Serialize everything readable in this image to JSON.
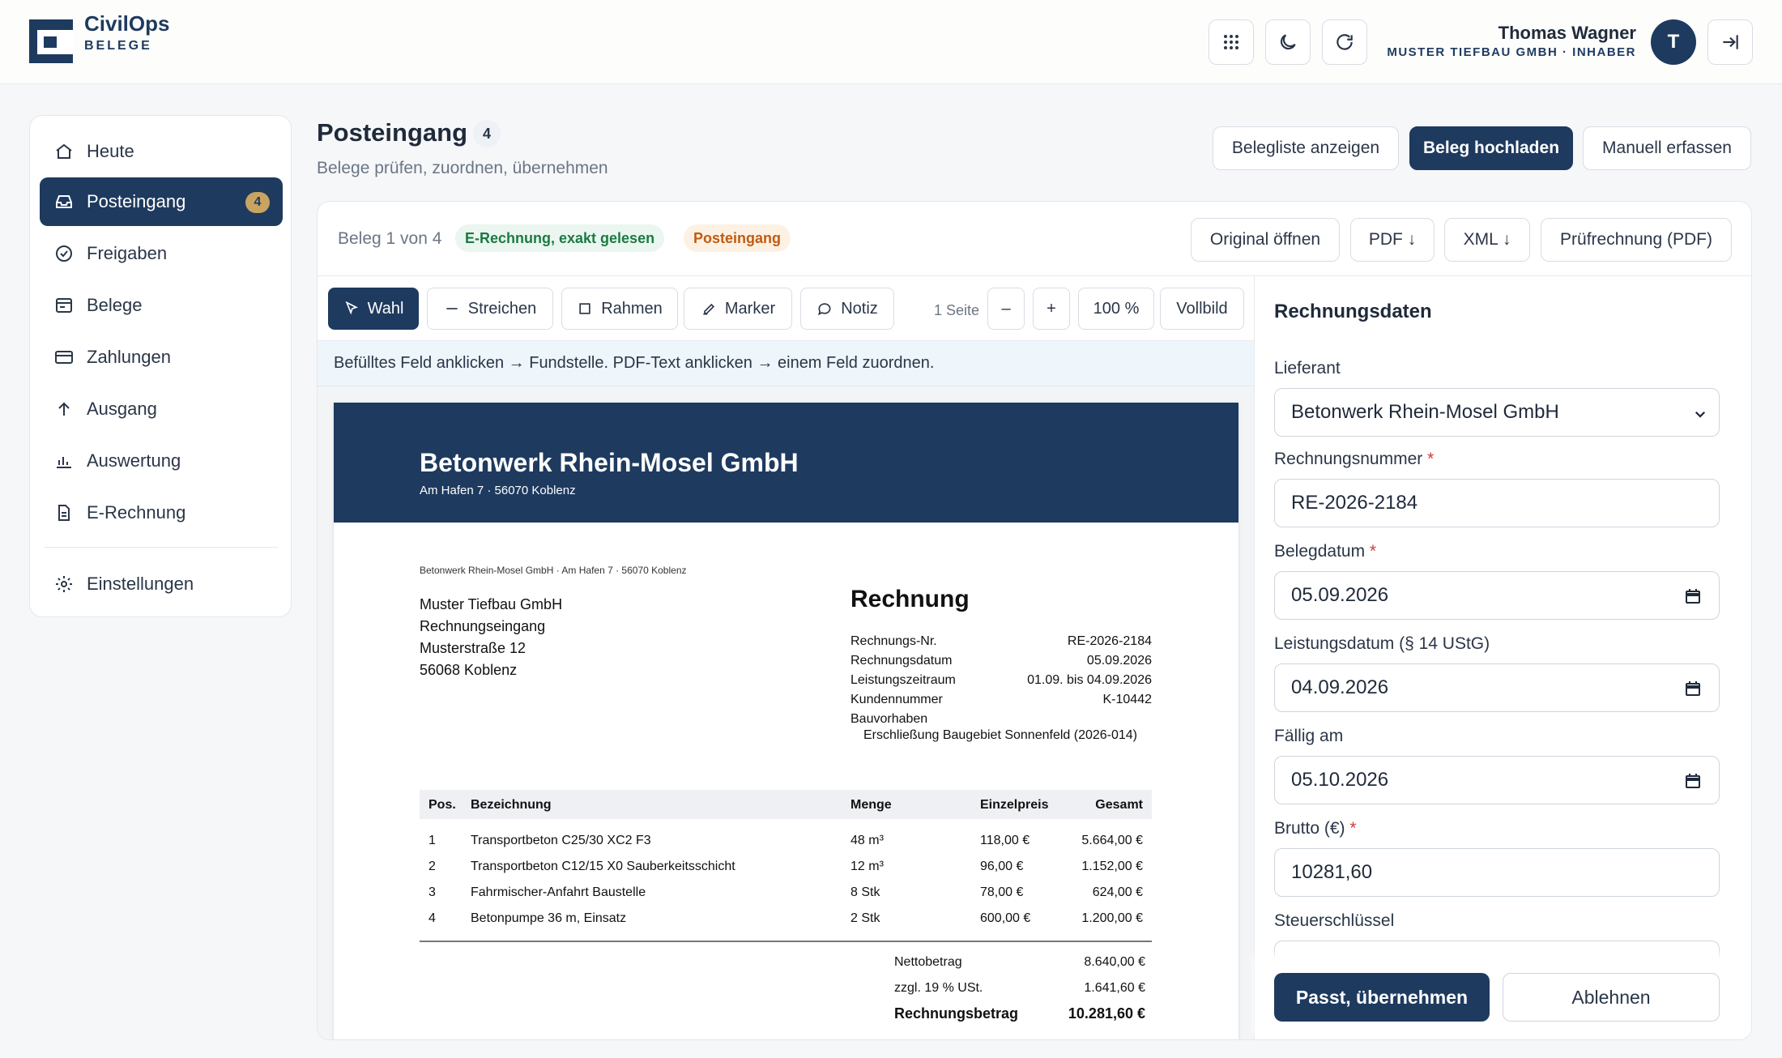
{
  "app": {
    "name": "CivilOps",
    "subtitle": "BELEGE"
  },
  "user": {
    "name": "Thomas Wagner",
    "role": "MUSTER TIEFBAU GMBH · INHABER",
    "initial": "T"
  },
  "topbar_icons": [
    "apps-grid-icon",
    "moon-icon",
    "refresh-icon",
    "logout-icon"
  ],
  "sidebar": {
    "items": [
      {
        "label": "Heute",
        "icon": "home-icon"
      },
      {
        "label": "Posteingang",
        "icon": "inbox-icon",
        "badge": "4",
        "active": true
      },
      {
        "label": "Freigaben",
        "icon": "check-circle-icon"
      },
      {
        "label": "Belege",
        "icon": "document-icon"
      },
      {
        "label": "Zahlungen",
        "icon": "credit-card-icon"
      },
      {
        "label": "Ausgang",
        "icon": "arrow-up-icon"
      },
      {
        "label": "Auswertung",
        "icon": "bar-chart-icon"
      },
      {
        "label": "E-Rechnung",
        "icon": "file-text-icon"
      }
    ],
    "settings": {
      "label": "Einstellungen",
      "icon": "gear-icon"
    }
  },
  "page": {
    "title": "Posteingang",
    "count": "4",
    "subtitle": "Belege prüfen, zuordnen, übernehmen",
    "actions": [
      "Belegliste anzeigen",
      "Beleg hochladen",
      "Manuell erfassen"
    ]
  },
  "card": {
    "position": "Beleg 1 von 4",
    "chip_erechnung": "E-Rechnung, exakt gelesen",
    "chip_status": "Posteingang",
    "buttons": [
      "Original öffnen",
      "PDF ↓",
      "XML ↓",
      "Prüfrechnung (PDF)"
    ]
  },
  "toolbar": {
    "tools": [
      "Wahl",
      "Streichen",
      "Rahmen",
      "Marker",
      "Notiz"
    ],
    "pages": "1 Seite",
    "zoom_out": "–",
    "zoom_in": "+",
    "zoom": "100 %",
    "fullscreen": "Vollbild",
    "hint": "Befülltes Feld anklicken → Fundstelle. PDF-Text anklicken → einem Feld zuordnen."
  },
  "invoice": {
    "company": "Betonwerk Rhein-Mosel GmbH",
    "company_address": "Am Hafen 7 · 56070 Koblenz",
    "sender_line": "Betonwerk Rhein-Mosel GmbH · Am Hafen 7 · 56070 Koblenz",
    "recipient": [
      "Muster Tiefbau GmbH",
      "Rechnungseingang",
      "Musterstraße 12",
      "56068 Koblenz"
    ],
    "title": "Rechnung",
    "meta": [
      {
        "key": "Rechnungs-Nr.",
        "value": "RE-2026-2184"
      },
      {
        "key": "Rechnungsdatum",
        "value": "05.09.2026"
      },
      {
        "key": "Leistungszeitraum",
        "value": "01.09. bis 04.09.2026"
      },
      {
        "key": "Kundennummer",
        "value": "K-10442"
      },
      {
        "key": "Bauvorhaben",
        "value": ""
      }
    ],
    "bauvorhaben": "Erschließung Baugebiet Sonnenfeld (2026-014)",
    "columns": [
      "Pos.",
      "Bezeichnung",
      "Menge",
      "Einzelpreis",
      "Gesamt"
    ],
    "items": [
      {
        "pos": "1",
        "desc": "Transportbeton C25/30 XC2 F3",
        "qty": "48 m³",
        "unit": "118,00 €",
        "total": "5.664,00 €"
      },
      {
        "pos": "2",
        "desc": "Transportbeton C12/15 X0 Sauberkeitsschicht",
        "qty": "12 m³",
        "unit": "96,00 €",
        "total": "1.152,00 €"
      },
      {
        "pos": "3",
        "desc": "Fahrmischer-Anfahrt Baustelle",
        "qty": "8 Stk",
        "unit": "78,00 €",
        "total": "624,00 €"
      },
      {
        "pos": "4",
        "desc": "Betonpumpe 36 m, Einsatz",
        "qty": "2 Stk",
        "unit": "600,00 €",
        "total": "1.200,00 €"
      }
    ],
    "totals": [
      {
        "key": "Nettobetrag",
        "value": "8.640,00 €"
      },
      {
        "key": "zzgl. 19 % USt.",
        "value": "1.641,60 €"
      },
      {
        "key": "Rechnungsbetrag",
        "value": "10.281,60 €"
      }
    ]
  },
  "form": {
    "title": "Rechnungsdaten",
    "lieferant_label": "Lieferant",
    "lieferant": "Betonwerk Rhein-Mosel GmbH",
    "rechnungsnummer_label": "Rechnungsnummer",
    "rechnungsnummer": "RE-2026-2184",
    "belegdatum_label": "Belegdatum",
    "belegdatum": "05.09.2026",
    "leistungsdatum_label": "Leistungsdatum (§ 14 UStG)",
    "leistungsdatum": "04.09.2026",
    "faellig_label": "Fällig am",
    "faellig": "05.10.2026",
    "brutto_label": "Brutto (€)",
    "brutto": "10281,60",
    "steuer_label": "Steuerschlüssel",
    "required_mark": "*",
    "accept": "Passt, übernehmen",
    "reject": "Ablehnen"
  },
  "colors": {
    "primary": "#1e3a5f",
    "badge": "#c9a461",
    "success": "#1c7a45",
    "warning": "#c05b11",
    "required": "#d23c3c"
  }
}
